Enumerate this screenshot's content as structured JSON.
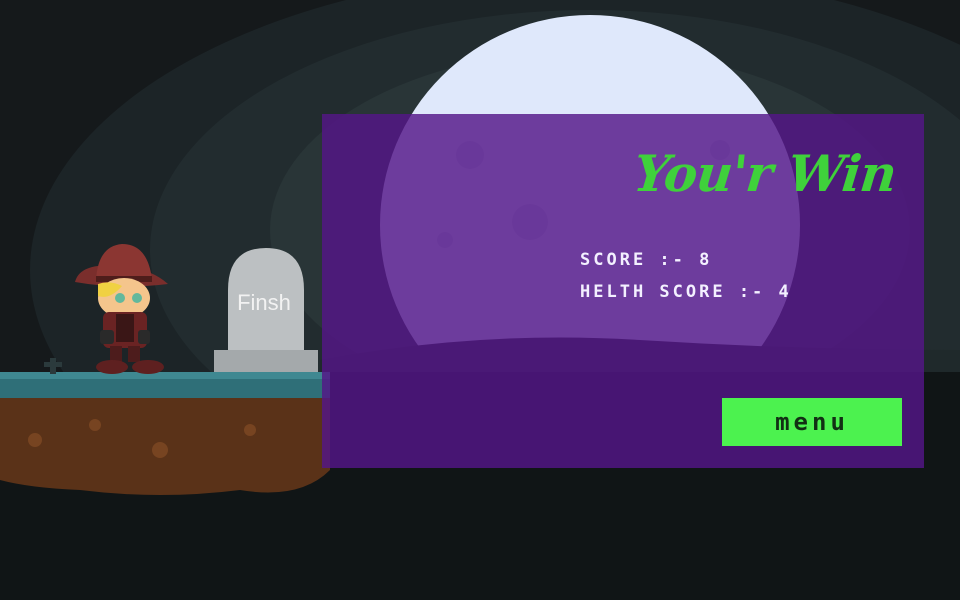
{
  "scene": {
    "tombstone_label": "Finsh"
  },
  "panel": {
    "title": "You'r Win",
    "score_label": "SCORE :- ",
    "score_value": "8",
    "health_label": "HELTH SCORE :- ",
    "health_value": "4",
    "menu_label": "MENU"
  },
  "colors": {
    "panel_bg": "#541687",
    "title_green": "#3fd13b",
    "button_green": "#4cf24f",
    "moon": "#dfe8fb"
  }
}
